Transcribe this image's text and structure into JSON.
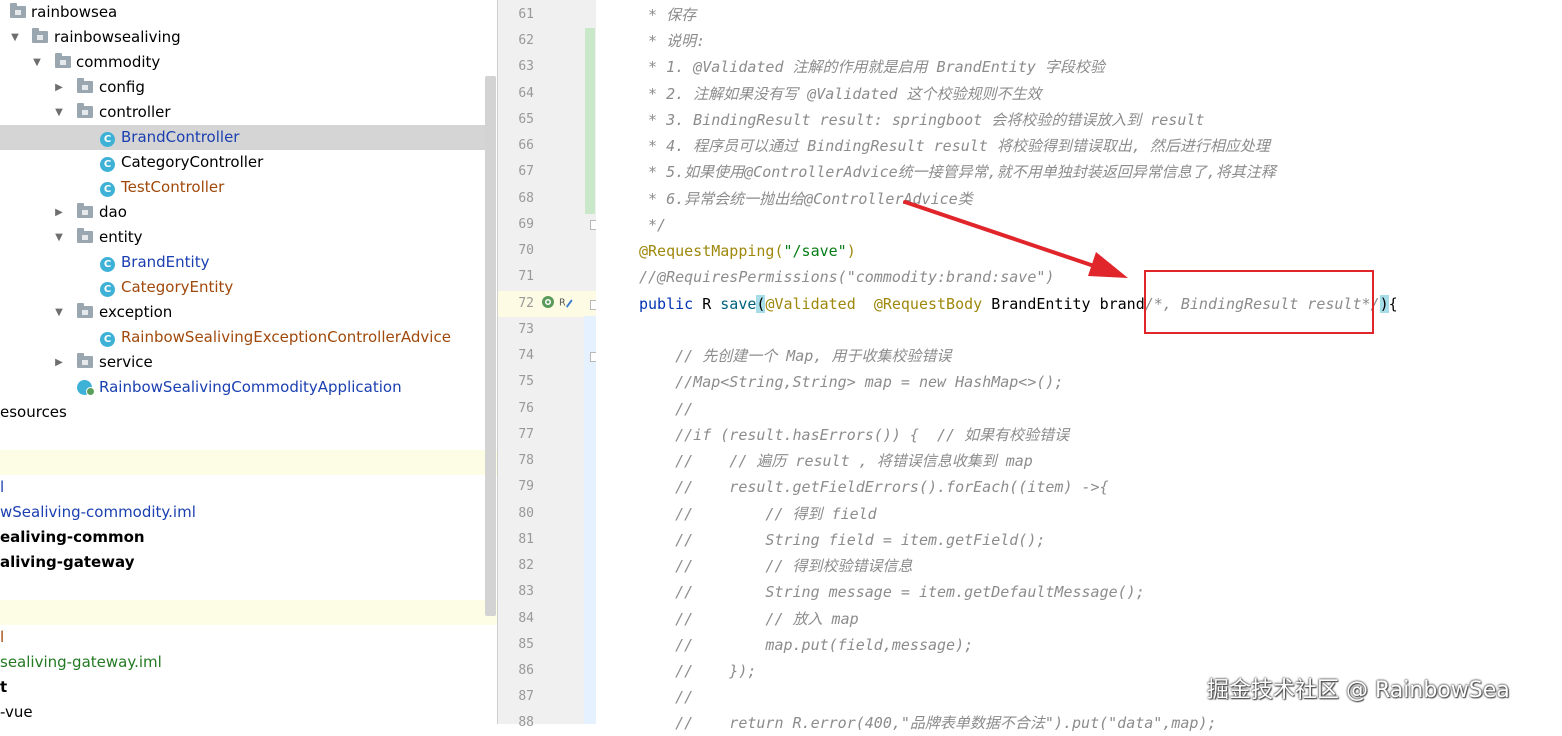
{
  "project_tree": {
    "items": [
      {
        "label": "rainbowsea",
        "icon": "folder-icon",
        "expanded": true
      },
      {
        "label": "rainbowsealiving",
        "icon": "folder-icon",
        "expanded": true
      },
      {
        "label": "commodity",
        "icon": "folder-icon",
        "expanded": true
      },
      {
        "label": "config",
        "icon": "folder-icon",
        "expanded": false
      },
      {
        "label": "controller",
        "icon": "folder-icon",
        "expanded": true
      },
      {
        "label": "BrandController",
        "icon": "class-icon",
        "selected": true
      },
      {
        "label": "CategoryController",
        "icon": "class-icon"
      },
      {
        "label": "TestController",
        "icon": "class-icon"
      },
      {
        "label": "dao",
        "icon": "folder-icon",
        "expanded": false
      },
      {
        "label": "entity",
        "icon": "folder-icon",
        "expanded": true
      },
      {
        "label": "BrandEntity",
        "icon": "class-icon"
      },
      {
        "label": "CategoryEntity",
        "icon": "class-icon"
      },
      {
        "label": "exception",
        "icon": "folder-icon",
        "expanded": true
      },
      {
        "label": "RainbowSealivingExceptionControllerAdvice",
        "icon": "class-icon"
      },
      {
        "label": "service",
        "icon": "folder-icon",
        "expanded": false
      },
      {
        "label": "RainbowSealivingCommodityApplication",
        "icon": "spring-boot-app-icon"
      },
      {
        "label": "esources"
      },
      {
        "label": "l"
      },
      {
        "label": "wSealiving-commodity.iml"
      },
      {
        "label": "ealiving-common"
      },
      {
        "label": "aliving-gateway"
      },
      {
        "label": "l"
      },
      {
        "label": "sealiving-gateway.iml"
      },
      {
        "label": "t"
      },
      {
        "label": "-vue"
      }
    ]
  },
  "editor": {
    "line_numbers": [
      "61",
      "62",
      "63",
      "64",
      "65",
      "66",
      "67",
      "68",
      "69",
      "70",
      "71",
      "72",
      "73",
      "74",
      "75",
      "76",
      "77",
      "78",
      "79",
      "80",
      "81",
      "82",
      "83",
      "84",
      "85",
      "86",
      "87",
      "88"
    ],
    "comments": {
      "l61": " * 保存",
      "l62": " * 说明:",
      "l63": " * 1. @Validated 注解的作用就是启用 BrandEntity 字段校验",
      "l64": " * 2. 注解如果没有写 @Validated 这个校验规则不生效",
      "l65": " * 3. BindingResult result: springboot 会将校验的错误放入到 result",
      "l66": " * 4. 程序员可以通过 BindingResult result 将校验得到错误取出, 然后进行相应处理",
      "l67": " * 5.如果使用@ControllerAdvice统一接管异常,就不用单独封装返回异常信息了,将其注释",
      "l68": " * 6.异常会统一抛出给@ControllerAdvice类",
      "l69": " */"
    },
    "l70": {
      "annotation": "@RequestMapping(",
      "string": "\"/save\"",
      "close": ")"
    },
    "l71": "//@RequiresPermissions(\"commodity:brand:save\")",
    "l72": {
      "kw_public": "public ",
      "type_r": "R ",
      "method": "save",
      "open": "(",
      "ann_validated": "@Validated",
      "gap": "  ",
      "ann_requestbody": "@RequestBody",
      "param": " BrandEntity brand",
      "inline_comment": "/*, BindingResult result*/",
      "close": ")",
      "brace": "{"
    },
    "l74": "    // 先创建一个 Map, 用于收集校验错误",
    "l75": "    //Map<String,String> map = new HashMap<>();",
    "l76": "    //",
    "l77": "    //if (result.hasErrors()) {  // 如果有校验错误",
    "l78": "    //    // 遍历 result , 将错误信息收集到 map",
    "l79": "    //    result.getFieldErrors().forEach((item) ->{",
    "l80": "    //        // 得到 field",
    "l81": "    //        String field = item.getField();",
    "l82": "    //        // 得到校验错误信息",
    "l83": "    //        String message = item.getDefaultMessage();",
    "l84": "    //        // 放入 map",
    "l85": "    //        map.put(field,message);",
    "l86": "    //    });",
    "l87": "    //",
    "l88": "    //    return R.error(400,\"品牌表单数据不合法\").put(\"data\",map);"
  },
  "annotation_color": "#e0262b",
  "watermark": "掘金技术社区 @ RainbowSea"
}
